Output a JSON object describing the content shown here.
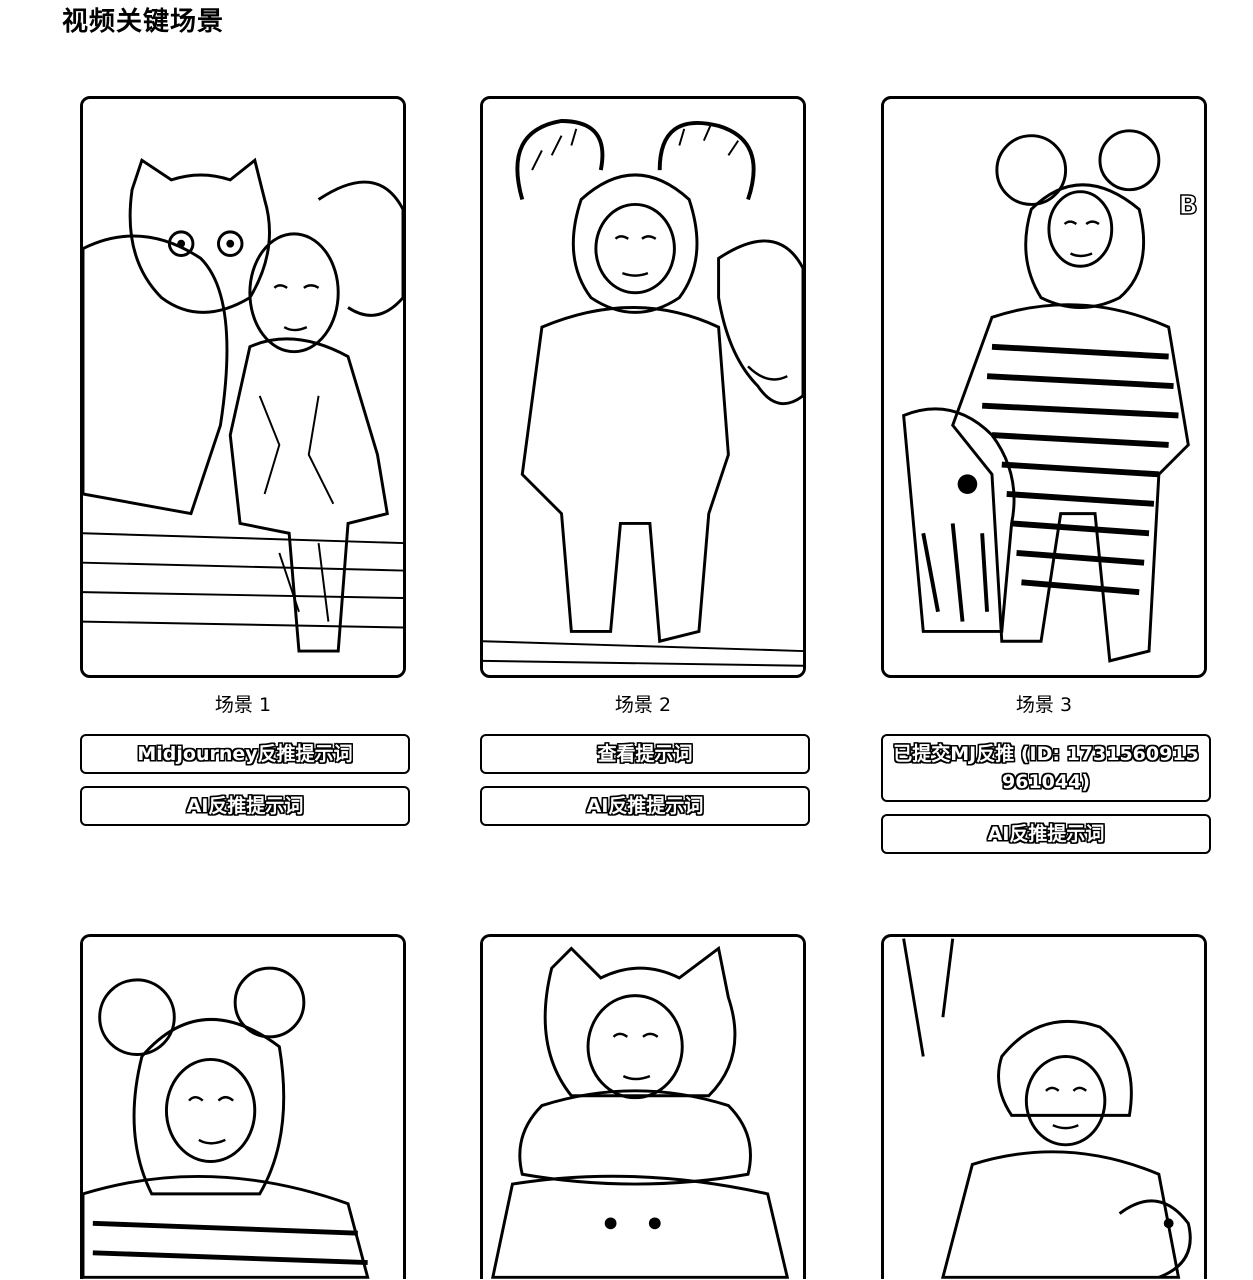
{
  "page": {
    "title": "视频关键场景"
  },
  "scenes": [
    {
      "label": "场景 1",
      "image_icon": "baby-with-white-cat-icon",
      "buttons": [
        "Midjourney反推提示词",
        "AI反推提示词"
      ]
    },
    {
      "label": "场景 2",
      "image_icon": "baby-in-sheep-costume-icon",
      "buttons": [
        "查看提示词",
        "AI反推提示词"
      ]
    },
    {
      "label": "场景 3",
      "image_icon": "baby-in-striped-suit-with-toy-icon",
      "buttons": [
        "已提交MJ反推 (ID: 1731560915961044)",
        "AI反推提示词"
      ]
    },
    {
      "image_icon": "baby-in-bear-hat-icon"
    },
    {
      "image_icon": "baby-in-fluffy-coat-icon"
    },
    {
      "image_icon": "baby-in-knit-hat-icon"
    }
  ]
}
